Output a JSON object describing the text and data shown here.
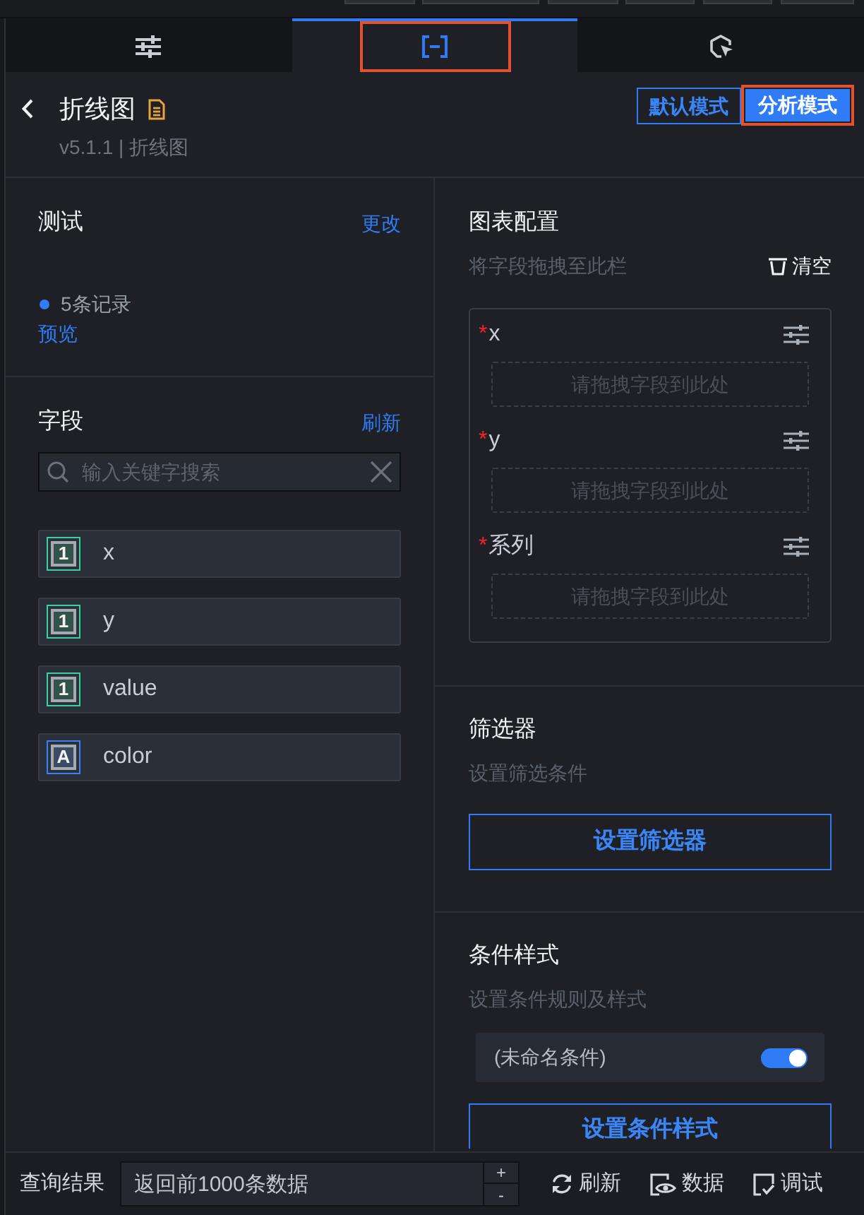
{
  "tabs": [
    {
      "kind": "sliders",
      "selected": false,
      "highlighted": false
    },
    {
      "kind": "brackets",
      "selected": true,
      "highlighted": true
    },
    {
      "kind": "cursor",
      "selected": false,
      "highlighted": false
    }
  ],
  "header": {
    "title": "折线图",
    "subtitle": "v5.1.1 | 折线图",
    "modes": [
      {
        "label": "默认模式",
        "selected": false,
        "highlighted": false
      },
      {
        "label": "分析模式",
        "selected": true,
        "highlighted": true
      }
    ]
  },
  "data_source": {
    "title": "测试",
    "action": "更改",
    "records": "5条记录",
    "preview": "预览"
  },
  "fields": {
    "title": "字段",
    "action": "刷新",
    "search": {
      "placeholder": "输入关键字搜索"
    },
    "items": [
      {
        "name": "x",
        "kind": "number",
        "type_mark": "1"
      },
      {
        "name": "y",
        "kind": "number",
        "type_mark": "1"
      },
      {
        "name": "value",
        "kind": "number",
        "type_mark": "1"
      },
      {
        "name": "color",
        "kind": "text",
        "type_mark": "A"
      }
    ]
  },
  "chart_config": {
    "title": "图表配置",
    "hint": "将字段拖拽至此栏",
    "clear": "清空",
    "slots": [
      {
        "required_mark": "*",
        "label": "x",
        "drop_hint": "请拖拽字段到此处"
      },
      {
        "required_mark": "*",
        "label": "y",
        "drop_hint": "请拖拽字段到此处"
      },
      {
        "required_mark": "*",
        "label": "系列",
        "drop_hint": "请拖拽字段到此处"
      }
    ]
  },
  "filter": {
    "title": "筛选器",
    "hint": "设置筛选条件",
    "button": "设置筛选器"
  },
  "conditional_style": {
    "title": "条件样式",
    "hint": "设置条件规则及样式",
    "rules": [
      {
        "name": "(未命名条件)",
        "on": true
      }
    ],
    "button": "设置条件样式"
  },
  "status_bar": {
    "label": "查询结果",
    "limit": {
      "value": "返回前1000条数据"
    },
    "stepper": [
      "+",
      "-"
    ],
    "actions": [
      {
        "kind": "refresh",
        "label": "刷新"
      },
      {
        "kind": "data",
        "label": "数据"
      },
      {
        "kind": "debug",
        "label": "调试"
      }
    ]
  }
}
